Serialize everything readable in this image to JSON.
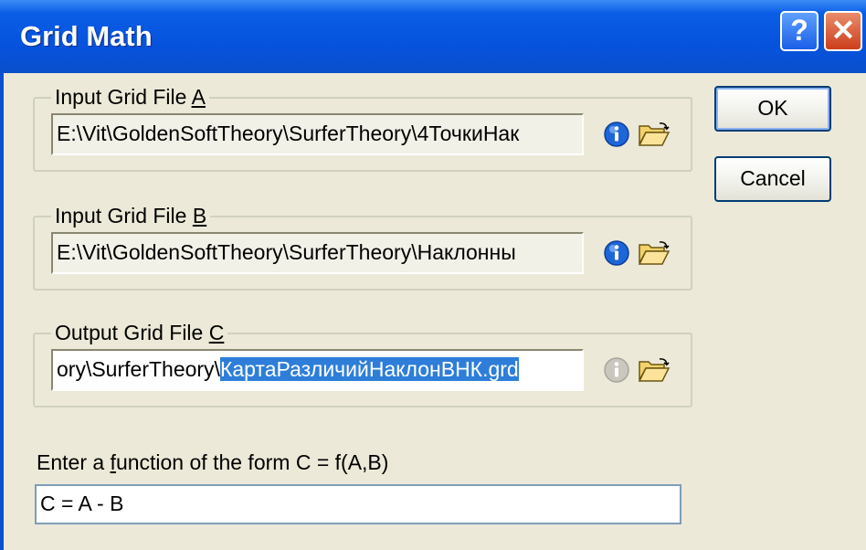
{
  "window": {
    "title": "Grid Math",
    "help_button": "?",
    "close_button": "✕"
  },
  "group_a": {
    "label_prefix": "Input Grid File ",
    "label_accel": "A",
    "path": "E:\\Vit\\GoldenSoftTheory\\SurferTheory\\4ТочкиНак"
  },
  "group_b": {
    "label_prefix": "Input Grid File ",
    "label_accel": "B",
    "path": "E:\\Vit\\GoldenSoftTheory\\SurferTheory\\Наклонны"
  },
  "group_c": {
    "label_prefix": "Output Grid File ",
    "label_accel": "C",
    "path_prefix": "ory\\SurferTheory\\",
    "path_selected": "КартаРазличийНаклонВНК.grd"
  },
  "buttons": {
    "ok": "OK",
    "cancel": "Cancel"
  },
  "function": {
    "label_pre": "Enter a ",
    "label_accel": "f",
    "label_post": "unction of the form C = f(A,B)",
    "value": "C = A - B"
  },
  "icons": {
    "info": "info-icon",
    "browse": "folder-open-icon",
    "info_color": "#1D66D8",
    "info_disabled_color": "#B9B7AE",
    "folder_color": "#F2D36A"
  }
}
